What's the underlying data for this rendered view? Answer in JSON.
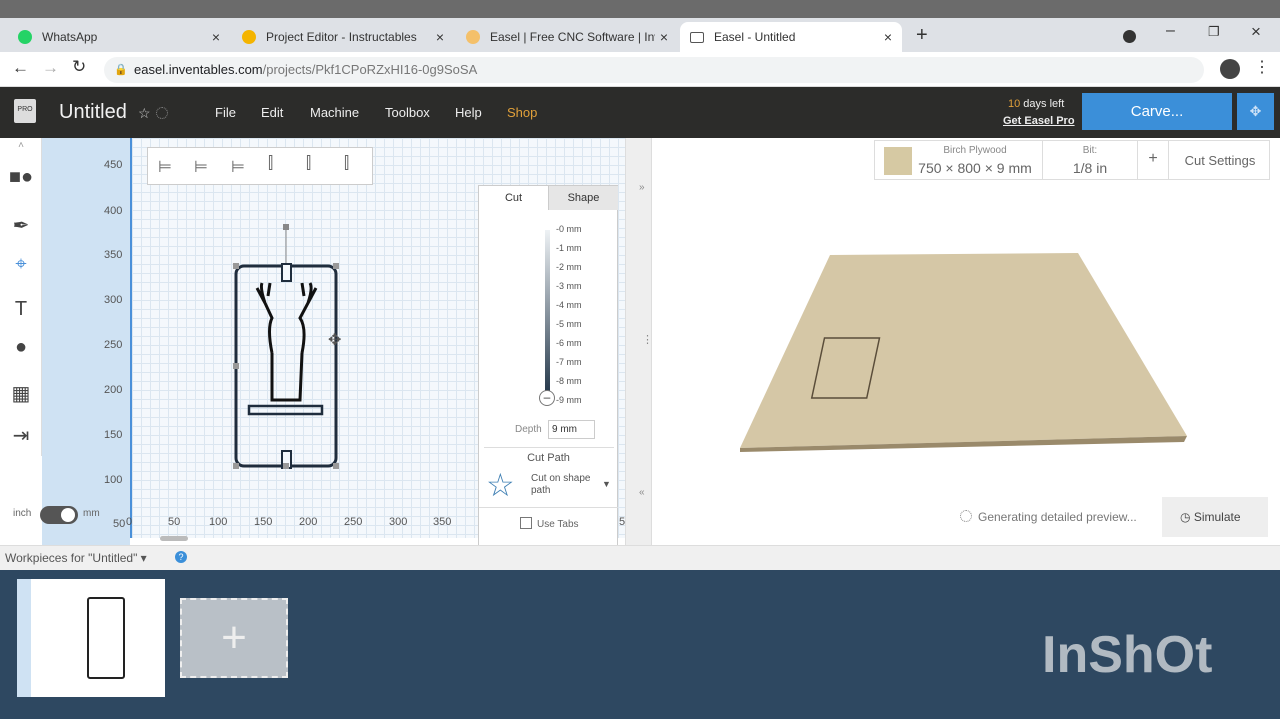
{
  "browser": {
    "tabs": [
      {
        "label": "WhatsApp",
        "icon": "whatsapp-icon",
        "color": "#25d366"
      },
      {
        "label": "Project Editor - Instructables",
        "icon": "instructables-icon",
        "color": "#f4b400"
      },
      {
        "label": "Easel | Free CNC Software | Inven",
        "icon": "easel-icon",
        "color": "#f4c06a"
      },
      {
        "label": "Easel - Untitled",
        "icon": "monitor-icon",
        "color": "#666"
      }
    ],
    "url_host": "easel.inventables.com",
    "url_path": "/projects/Pkf1CPoRZxHI16-0g9SoSA"
  },
  "header": {
    "title": "Untitled",
    "menu": [
      "File",
      "Edit",
      "Machine",
      "Toolbox",
      "Help",
      "Shop"
    ],
    "days_num": "10",
    "days_text": " days left",
    "get_pro": "Get Easel Pro",
    "carve": "Carve...",
    "accent": "#3b8fd9",
    "shop_color": "#e0a03a"
  },
  "ruler": {
    "y": [
      "450",
      "400",
      "350",
      "300",
      "250",
      "200",
      "150",
      "100",
      "50"
    ],
    "x": [
      "0",
      "50",
      "100",
      "150",
      "200",
      "250",
      "300",
      "350",
      "5"
    ]
  },
  "units": {
    "left": "inch",
    "right": "mm"
  },
  "cut_panel": {
    "tabs": [
      "Cut",
      "Shape"
    ],
    "depth_ticks": [
      "-0 mm",
      "-1 mm",
      "-2 mm",
      "-3 mm",
      "-4 mm",
      "-5 mm",
      "-6 mm",
      "-7 mm",
      "-8 mm",
      "-9 mm"
    ],
    "depth_label": "Depth",
    "depth_value": "9 mm",
    "cut_path_title": "Cut Path",
    "cut_path_option": "Cut on shape path",
    "use_tabs": "Use Tabs"
  },
  "material": {
    "name": "Birch Plywood",
    "size": "750 × 800 × 9 mm",
    "bit_label": "Bit:",
    "bit_value": "1/8 in",
    "plus": "+",
    "cut_settings": "Cut Settings"
  },
  "preview": {
    "status": "Generating detailed preview...",
    "simulate": "Simulate"
  },
  "workpieces": {
    "label": "Workpieces for \"Untitled\" ▾"
  },
  "watermark": "InShOt"
}
